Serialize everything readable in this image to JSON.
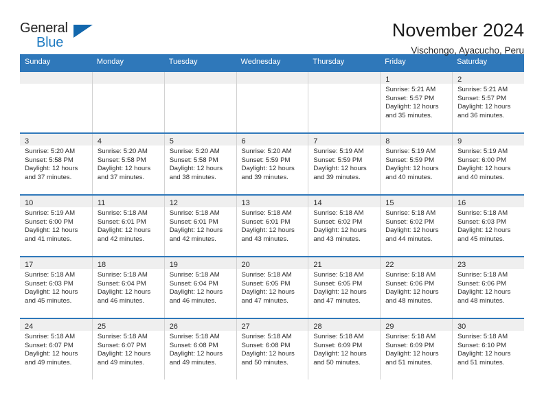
{
  "brand": {
    "line1": "General",
    "line2": "Blue",
    "triangle_color": "#1267ad"
  },
  "header": {
    "title": "November 2024",
    "location": "Vischongo, Ayacucho, Peru"
  },
  "theme": {
    "header_blue": "#2f78ba",
    "band_gray": "#efefef",
    "text": "#262626"
  },
  "weekday_headers": [
    "Sunday",
    "Monday",
    "Tuesday",
    "Wednesday",
    "Thursday",
    "Friday",
    "Saturday"
  ],
  "weeks": [
    [
      {
        "day": "",
        "sunrise": "",
        "sunset": "",
        "daylight_l1": "",
        "daylight_l2": ""
      },
      {
        "day": "",
        "sunrise": "",
        "sunset": "",
        "daylight_l1": "",
        "daylight_l2": ""
      },
      {
        "day": "",
        "sunrise": "",
        "sunset": "",
        "daylight_l1": "",
        "daylight_l2": ""
      },
      {
        "day": "",
        "sunrise": "",
        "sunset": "",
        "daylight_l1": "",
        "daylight_l2": ""
      },
      {
        "day": "",
        "sunrise": "",
        "sunset": "",
        "daylight_l1": "",
        "daylight_l2": ""
      },
      {
        "day": "1",
        "sunrise": "Sunrise: 5:21 AM",
        "sunset": "Sunset: 5:57 PM",
        "daylight_l1": "Daylight: 12 hours",
        "daylight_l2": "and 35 minutes."
      },
      {
        "day": "2",
        "sunrise": "Sunrise: 5:21 AM",
        "sunset": "Sunset: 5:57 PM",
        "daylight_l1": "Daylight: 12 hours",
        "daylight_l2": "and 36 minutes."
      }
    ],
    [
      {
        "day": "3",
        "sunrise": "Sunrise: 5:20 AM",
        "sunset": "Sunset: 5:58 PM",
        "daylight_l1": "Daylight: 12 hours",
        "daylight_l2": "and 37 minutes."
      },
      {
        "day": "4",
        "sunrise": "Sunrise: 5:20 AM",
        "sunset": "Sunset: 5:58 PM",
        "daylight_l1": "Daylight: 12 hours",
        "daylight_l2": "and 37 minutes."
      },
      {
        "day": "5",
        "sunrise": "Sunrise: 5:20 AM",
        "sunset": "Sunset: 5:58 PM",
        "daylight_l1": "Daylight: 12 hours",
        "daylight_l2": "and 38 minutes."
      },
      {
        "day": "6",
        "sunrise": "Sunrise: 5:20 AM",
        "sunset": "Sunset: 5:59 PM",
        "daylight_l1": "Daylight: 12 hours",
        "daylight_l2": "and 39 minutes."
      },
      {
        "day": "7",
        "sunrise": "Sunrise: 5:19 AM",
        "sunset": "Sunset: 5:59 PM",
        "daylight_l1": "Daylight: 12 hours",
        "daylight_l2": "and 39 minutes."
      },
      {
        "day": "8",
        "sunrise": "Sunrise: 5:19 AM",
        "sunset": "Sunset: 5:59 PM",
        "daylight_l1": "Daylight: 12 hours",
        "daylight_l2": "and 40 minutes."
      },
      {
        "day": "9",
        "sunrise": "Sunrise: 5:19 AM",
        "sunset": "Sunset: 6:00 PM",
        "daylight_l1": "Daylight: 12 hours",
        "daylight_l2": "and 40 minutes."
      }
    ],
    [
      {
        "day": "10",
        "sunrise": "Sunrise: 5:19 AM",
        "sunset": "Sunset: 6:00 PM",
        "daylight_l1": "Daylight: 12 hours",
        "daylight_l2": "and 41 minutes."
      },
      {
        "day": "11",
        "sunrise": "Sunrise: 5:18 AM",
        "sunset": "Sunset: 6:01 PM",
        "daylight_l1": "Daylight: 12 hours",
        "daylight_l2": "and 42 minutes."
      },
      {
        "day": "12",
        "sunrise": "Sunrise: 5:18 AM",
        "sunset": "Sunset: 6:01 PM",
        "daylight_l1": "Daylight: 12 hours",
        "daylight_l2": "and 42 minutes."
      },
      {
        "day": "13",
        "sunrise": "Sunrise: 5:18 AM",
        "sunset": "Sunset: 6:01 PM",
        "daylight_l1": "Daylight: 12 hours",
        "daylight_l2": "and 43 minutes."
      },
      {
        "day": "14",
        "sunrise": "Sunrise: 5:18 AM",
        "sunset": "Sunset: 6:02 PM",
        "daylight_l1": "Daylight: 12 hours",
        "daylight_l2": "and 43 minutes."
      },
      {
        "day": "15",
        "sunrise": "Sunrise: 5:18 AM",
        "sunset": "Sunset: 6:02 PM",
        "daylight_l1": "Daylight: 12 hours",
        "daylight_l2": "and 44 minutes."
      },
      {
        "day": "16",
        "sunrise": "Sunrise: 5:18 AM",
        "sunset": "Sunset: 6:03 PM",
        "daylight_l1": "Daylight: 12 hours",
        "daylight_l2": "and 45 minutes."
      }
    ],
    [
      {
        "day": "17",
        "sunrise": "Sunrise: 5:18 AM",
        "sunset": "Sunset: 6:03 PM",
        "daylight_l1": "Daylight: 12 hours",
        "daylight_l2": "and 45 minutes."
      },
      {
        "day": "18",
        "sunrise": "Sunrise: 5:18 AM",
        "sunset": "Sunset: 6:04 PM",
        "daylight_l1": "Daylight: 12 hours",
        "daylight_l2": "and 46 minutes."
      },
      {
        "day": "19",
        "sunrise": "Sunrise: 5:18 AM",
        "sunset": "Sunset: 6:04 PM",
        "daylight_l1": "Daylight: 12 hours",
        "daylight_l2": "and 46 minutes."
      },
      {
        "day": "20",
        "sunrise": "Sunrise: 5:18 AM",
        "sunset": "Sunset: 6:05 PM",
        "daylight_l1": "Daylight: 12 hours",
        "daylight_l2": "and 47 minutes."
      },
      {
        "day": "21",
        "sunrise": "Sunrise: 5:18 AM",
        "sunset": "Sunset: 6:05 PM",
        "daylight_l1": "Daylight: 12 hours",
        "daylight_l2": "and 47 minutes."
      },
      {
        "day": "22",
        "sunrise": "Sunrise: 5:18 AM",
        "sunset": "Sunset: 6:06 PM",
        "daylight_l1": "Daylight: 12 hours",
        "daylight_l2": "and 48 minutes."
      },
      {
        "day": "23",
        "sunrise": "Sunrise: 5:18 AM",
        "sunset": "Sunset: 6:06 PM",
        "daylight_l1": "Daylight: 12 hours",
        "daylight_l2": "and 48 minutes."
      }
    ],
    [
      {
        "day": "24",
        "sunrise": "Sunrise: 5:18 AM",
        "sunset": "Sunset: 6:07 PM",
        "daylight_l1": "Daylight: 12 hours",
        "daylight_l2": "and 49 minutes."
      },
      {
        "day": "25",
        "sunrise": "Sunrise: 5:18 AM",
        "sunset": "Sunset: 6:07 PM",
        "daylight_l1": "Daylight: 12 hours",
        "daylight_l2": "and 49 minutes."
      },
      {
        "day": "26",
        "sunrise": "Sunrise: 5:18 AM",
        "sunset": "Sunset: 6:08 PM",
        "daylight_l1": "Daylight: 12 hours",
        "daylight_l2": "and 49 minutes."
      },
      {
        "day": "27",
        "sunrise": "Sunrise: 5:18 AM",
        "sunset": "Sunset: 6:08 PM",
        "daylight_l1": "Daylight: 12 hours",
        "daylight_l2": "and 50 minutes."
      },
      {
        "day": "28",
        "sunrise": "Sunrise: 5:18 AM",
        "sunset": "Sunset: 6:09 PM",
        "daylight_l1": "Daylight: 12 hours",
        "daylight_l2": "and 50 minutes."
      },
      {
        "day": "29",
        "sunrise": "Sunrise: 5:18 AM",
        "sunset": "Sunset: 6:09 PM",
        "daylight_l1": "Daylight: 12 hours",
        "daylight_l2": "and 51 minutes."
      },
      {
        "day": "30",
        "sunrise": "Sunrise: 5:18 AM",
        "sunset": "Sunset: 6:10 PM",
        "daylight_l1": "Daylight: 12 hours",
        "daylight_l2": "and 51 minutes."
      }
    ]
  ]
}
